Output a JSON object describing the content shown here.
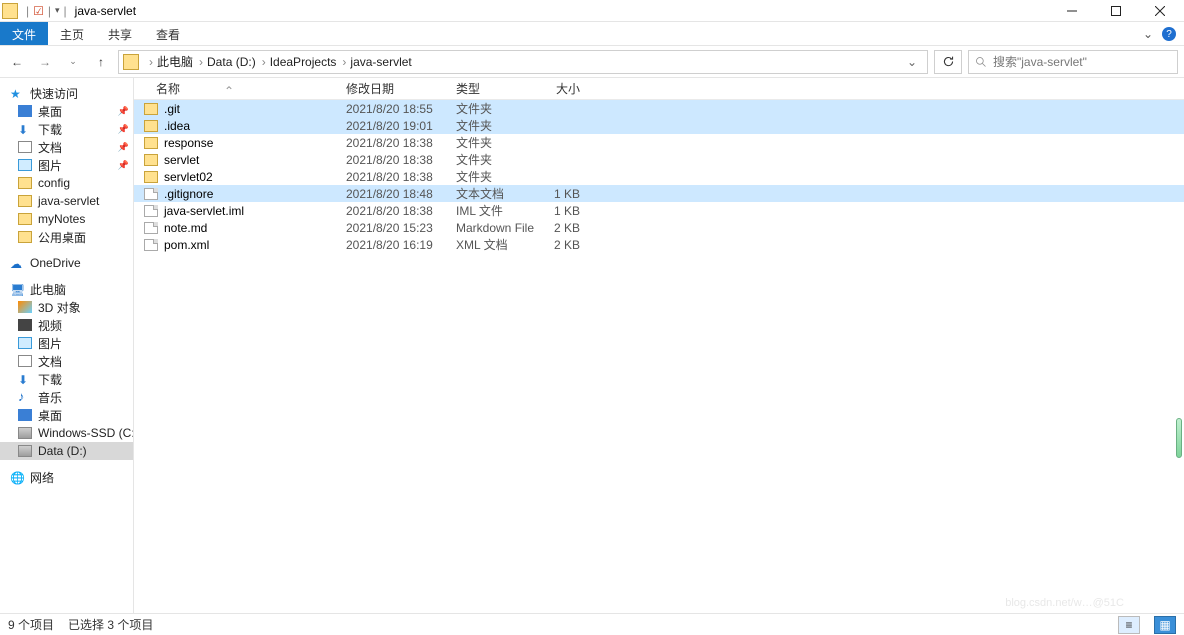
{
  "window": {
    "title": "java-servlet",
    "help_glyph": "?"
  },
  "ribbon": {
    "file": "文件",
    "home": "主页",
    "share": "共享",
    "view": "查看"
  },
  "address": {
    "crumbs": [
      "此电脑",
      "Data (D:)",
      "IdeaProjects",
      "java-servlet"
    ]
  },
  "search": {
    "placeholder": "搜索\"java-servlet\""
  },
  "sidebar": {
    "quick": "快速访问",
    "quick_items": [
      {
        "label": "桌面",
        "icon": "desk",
        "pinned": true
      },
      {
        "label": "下载",
        "icon": "dl",
        "pinned": true
      },
      {
        "label": "文档",
        "icon": "doc",
        "pinned": true
      },
      {
        "label": "图片",
        "icon": "pic",
        "pinned": true
      },
      {
        "label": "config",
        "icon": "folder",
        "pinned": false
      },
      {
        "label": "java-servlet",
        "icon": "folder",
        "pinned": false
      },
      {
        "label": "myNotes",
        "icon": "folder",
        "pinned": false
      },
      {
        "label": "公用桌面",
        "icon": "folder",
        "pinned": false
      }
    ],
    "onedrive": "OneDrive",
    "thispc": "此电脑",
    "pc_items": [
      {
        "label": "3D 对象",
        "icon": "threed"
      },
      {
        "label": "视频",
        "icon": "video"
      },
      {
        "label": "图片",
        "icon": "pic"
      },
      {
        "label": "文档",
        "icon": "doc"
      },
      {
        "label": "下载",
        "icon": "dl"
      },
      {
        "label": "音乐",
        "icon": "music"
      },
      {
        "label": "桌面",
        "icon": "desk"
      },
      {
        "label": "Windows-SSD (C:)",
        "icon": "drive"
      },
      {
        "label": "Data (D:)",
        "icon": "drive"
      }
    ],
    "network": "网络",
    "selected": "Data (D:)"
  },
  "columns": {
    "name": "名称",
    "date": "修改日期",
    "type": "类型",
    "size": "大小"
  },
  "rows": [
    {
      "name": ".git",
      "date": "2021/8/20 18:55",
      "type": "文件夹",
      "size": "",
      "kind": "folder",
      "sel": true
    },
    {
      "name": ".idea",
      "date": "2021/8/20 19:01",
      "type": "文件夹",
      "size": "",
      "kind": "folder",
      "sel": true
    },
    {
      "name": "response",
      "date": "2021/8/20 18:38",
      "type": "文件夹",
      "size": "",
      "kind": "folder",
      "sel": false
    },
    {
      "name": "servlet",
      "date": "2021/8/20 18:38",
      "type": "文件夹",
      "size": "",
      "kind": "folder",
      "sel": false
    },
    {
      "name": "servlet02",
      "date": "2021/8/20 18:38",
      "type": "文件夹",
      "size": "",
      "kind": "folder",
      "sel": false
    },
    {
      "name": ".gitignore",
      "date": "2021/8/20 18:48",
      "type": "文本文档",
      "size": "1 KB",
      "kind": "file",
      "sel": true
    },
    {
      "name": "java-servlet.iml",
      "date": "2021/8/20 18:38",
      "type": "IML 文件",
      "size": "1 KB",
      "kind": "file",
      "sel": false
    },
    {
      "name": "note.md",
      "date": "2021/8/20 15:23",
      "type": "Markdown File",
      "size": "2 KB",
      "kind": "file",
      "sel": false
    },
    {
      "name": "pom.xml",
      "date": "2021/8/20 16:19",
      "type": "XML 文档",
      "size": "2 KB",
      "kind": "file",
      "sel": false
    }
  ],
  "status": {
    "count": "9 个项目",
    "selected": "已选择 3 个项目"
  }
}
